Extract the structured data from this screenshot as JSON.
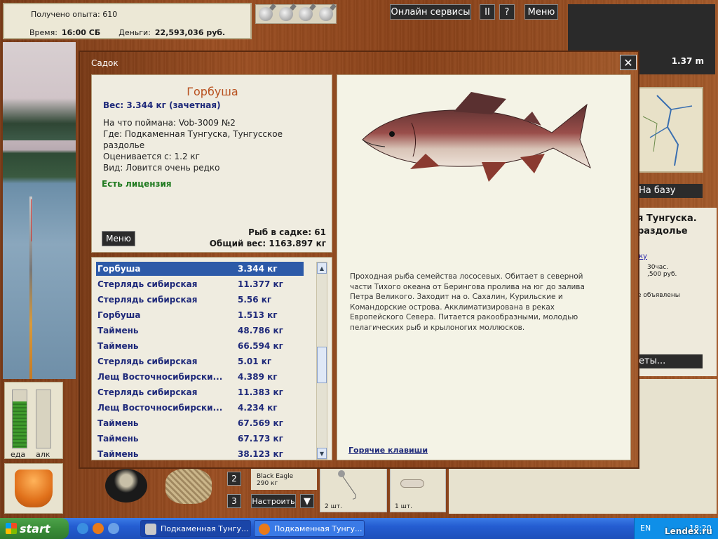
{
  "hud": {
    "exp_label": "Получено опыта:",
    "exp_value": "610",
    "time_label": "Время:",
    "time_value": "16:00 СБ",
    "money_label": "Деньги:",
    "money_value": "22,593,036 руб."
  },
  "top_buttons": {
    "online": "Онлайн сервисы",
    "pause": "II",
    "help": "?",
    "menu": "Меню"
  },
  "depth": "1.37 m",
  "right": {
    "to_base": "На базу",
    "location_1": "я Тунгуска.",
    "location_2": "раздолье",
    "link": "ку",
    "days": "30час.",
    "price": ",500 руб.",
    "ads": "е объявлены",
    "btn": "еты..."
  },
  "meters": {
    "food_label": "еда",
    "alc_label": "алк",
    "food_level": 0.8,
    "alc_level": 0.0
  },
  "slots": {
    "n2": "2",
    "n3": "3",
    "setup": "Настроить",
    "setup_down": "▼",
    "lure_name": "Black Eagle",
    "lure_weight": "290 кг",
    "tack1_count": "2 шт.",
    "tack2_count": "1 шт."
  },
  "dialog": {
    "title": "Садок",
    "close": "✕",
    "fish_name": "Горбуша",
    "weight": "Вес: 3.344 кг (зачетная)",
    "caught_with": "На что поймана: Vob-3009 №2",
    "where": "Где: Подкаменная Тунгуска, Тунгусское раздолье",
    "rated_from": "Оценивается с: 1.2 кг",
    "kind": "Вид: Ловится очень редко",
    "license": "Есть лицензия",
    "menu": "Меню",
    "fish_in_keepnet": "Рыб в садке: 61",
    "total_weight": "Общий вес: 1163.897 кг",
    "description": "Проходная рыба семейства лососевых. Обитает  в северной части Тихого океана от Берингова пролива на юг до залива Петра Великого. Заходит на о. Сахалин, Курильские и Командорские острова. Акклиматизирована в реках Европейского Севера. Питается ракообразными, молодью пелагических рыб и крылоногих моллюсков.",
    "hotkeys": "Горячие клавиши",
    "scroll_up": "▲",
    "scroll_down": "▼",
    "fish_list": [
      {
        "name": "Горбуша",
        "weight": "3.344 кг"
      },
      {
        "name": "Стерлядь сибирская",
        "weight": "11.377 кг"
      },
      {
        "name": "Стерлядь сибирская",
        "weight": "5.56 кг"
      },
      {
        "name": "Горбуша",
        "weight": "1.513 кг"
      },
      {
        "name": "Таймень",
        "weight": "48.786 кг"
      },
      {
        "name": "Таймень",
        "weight": "66.594 кг"
      },
      {
        "name": "Стерлядь сибирская",
        "weight": "5.01 кг"
      },
      {
        "name": "Лещ Восточносибирски...",
        "weight": "4.389 кг"
      },
      {
        "name": "Стерлядь сибирская",
        "weight": "11.383 кг"
      },
      {
        "name": "Лещ Восточносибирски...",
        "weight": "4.234 кг"
      },
      {
        "name": "Таймень",
        "weight": "67.569 кг"
      },
      {
        "name": "Таймень",
        "weight": "67.173 кг"
      },
      {
        "name": "Таймень",
        "weight": "38.123 кг"
      }
    ]
  },
  "taskbar": {
    "start": "start",
    "task1": "Подкаменная Тунгу...",
    "task2": "Подкаменная Тунгу...",
    "lang": "EN",
    "clock": "18:20"
  },
  "watermark": "Lendex.ru",
  "colors": {
    "fish_name": "#b8501e",
    "list_text": "#1f2a7a",
    "selection": "#2d5aa8",
    "license": "#1f7a1f"
  }
}
